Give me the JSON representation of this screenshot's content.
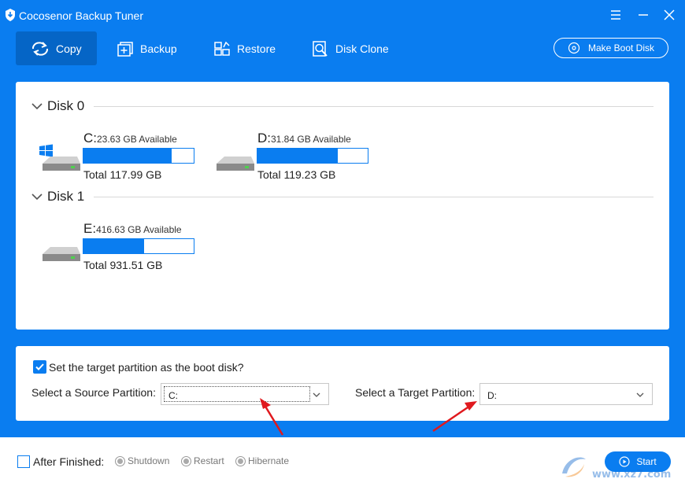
{
  "app": {
    "title": "Cocosenor Backup Tuner"
  },
  "nav": {
    "tabs": [
      {
        "label": "Copy",
        "icon": "copy-icon",
        "active": true
      },
      {
        "label": "Backup",
        "icon": "backup-icon",
        "active": false
      },
      {
        "label": "Restore",
        "icon": "restore-icon",
        "active": false
      },
      {
        "label": "Disk Clone",
        "icon": "disk-clone-icon",
        "active": false
      }
    ],
    "boot_disk_label": "Make Boot Disk"
  },
  "disks": [
    {
      "name": "Disk 0",
      "partitions": [
        {
          "letter": "C:",
          "available": "23.63 GB Available",
          "total": "Total 117.99 GB",
          "used_fraction": 0.8,
          "system": true
        },
        {
          "letter": "D:",
          "available": "31.84 GB Available",
          "total": "Total 119.23 GB",
          "used_fraction": 0.73,
          "system": false
        }
      ]
    },
    {
      "name": "Disk 1",
      "partitions": [
        {
          "letter": "E:",
          "available": "416.63 GB Available",
          "total": "Total 931.51 GB",
          "used_fraction": 0.55,
          "system": false
        }
      ]
    }
  ],
  "options": {
    "boot_checkbox_label": "Set the target partition as the boot disk?",
    "boot_checked": true,
    "source_label": "Select a Source Partition:",
    "source_value": "C:",
    "target_label": "Select a Target Partition:",
    "target_value": "D:"
  },
  "footer": {
    "after_finished_label": "After Finished:",
    "after_finished_checked": false,
    "radios": [
      "Shutdown",
      "Restart",
      "Hibernate"
    ],
    "start_label": "Start",
    "watermark_text": "www.xz7.com"
  },
  "colors": {
    "accent": "#0a7df0",
    "accent_dark": "#0565c6",
    "arrow": "#e0191e"
  }
}
